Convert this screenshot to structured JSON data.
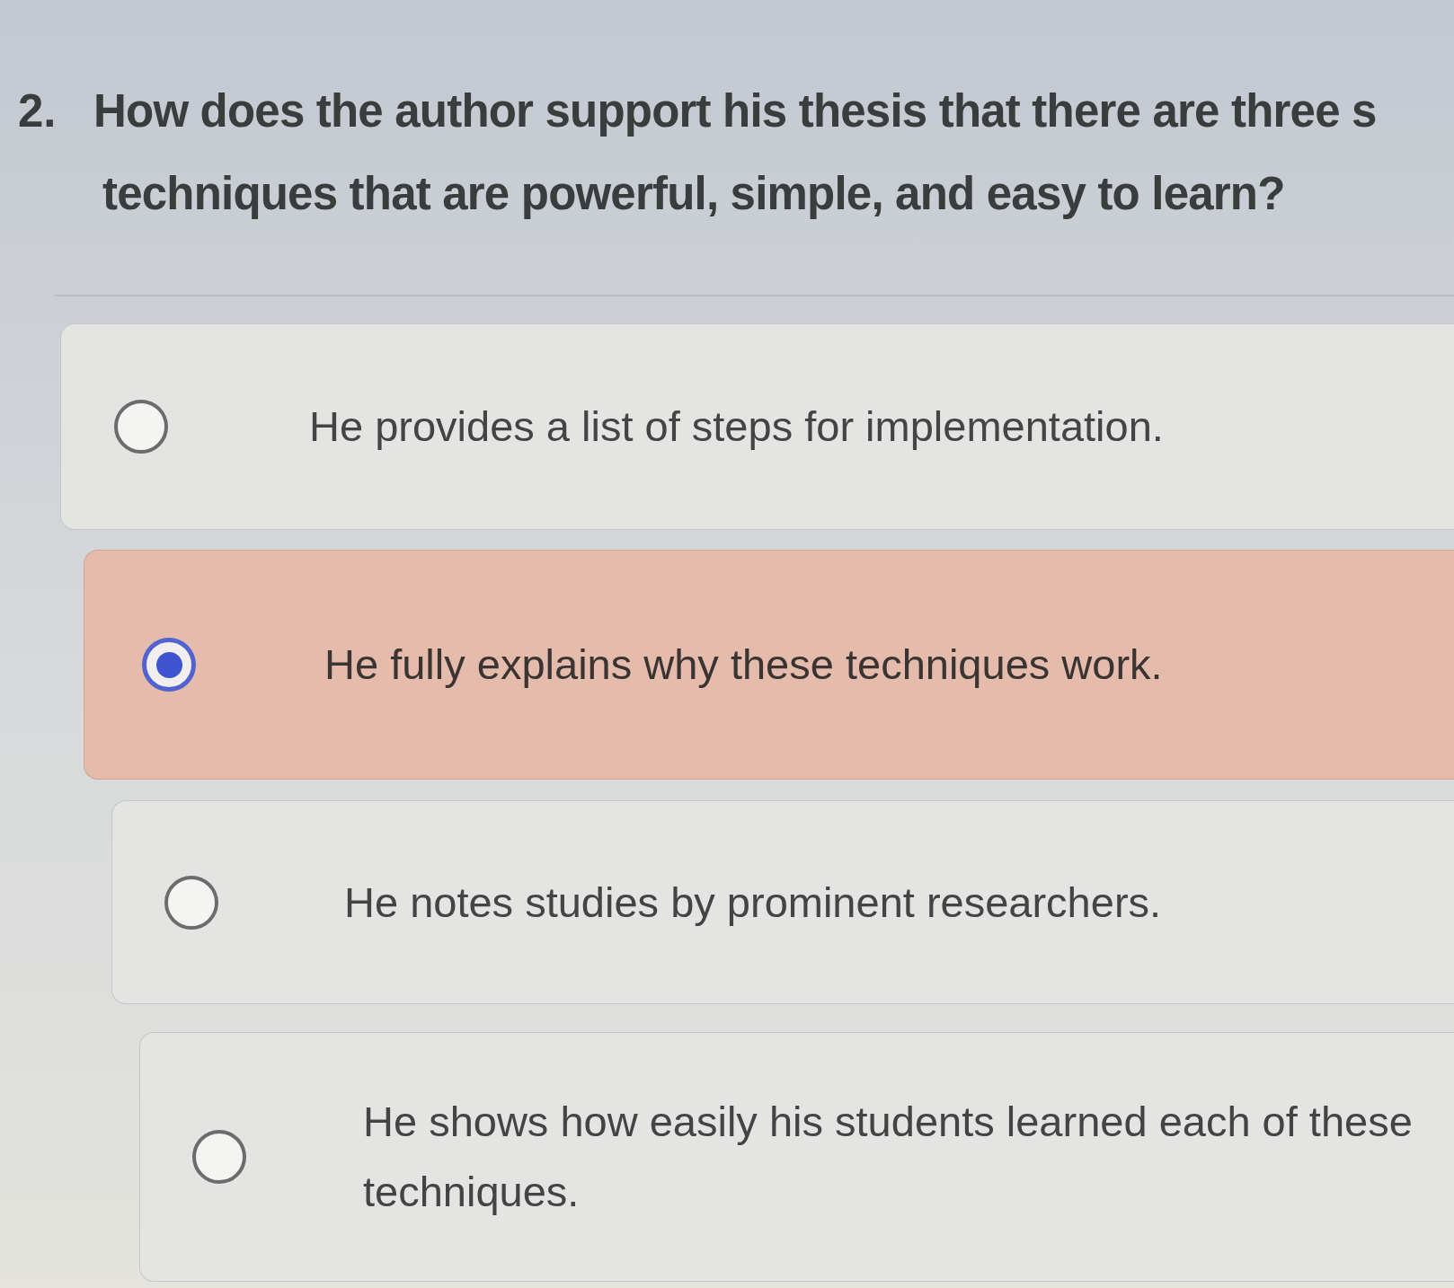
{
  "question": {
    "number": "2.",
    "text_lines": [
      "How does the author support his thesis that there are three s",
      "techniques that are powerful, simple, and easy to learn?"
    ]
  },
  "options": [
    {
      "label": "He provides a list of steps for implementation.",
      "selected": false
    },
    {
      "label": "He fully explains why these techniques work.",
      "selected": true
    },
    {
      "label": "He notes studies by prominent researchers.",
      "selected": false
    },
    {
      "label": "He shows how easily his students learned each of these techniques.",
      "selected": false
    }
  ]
}
